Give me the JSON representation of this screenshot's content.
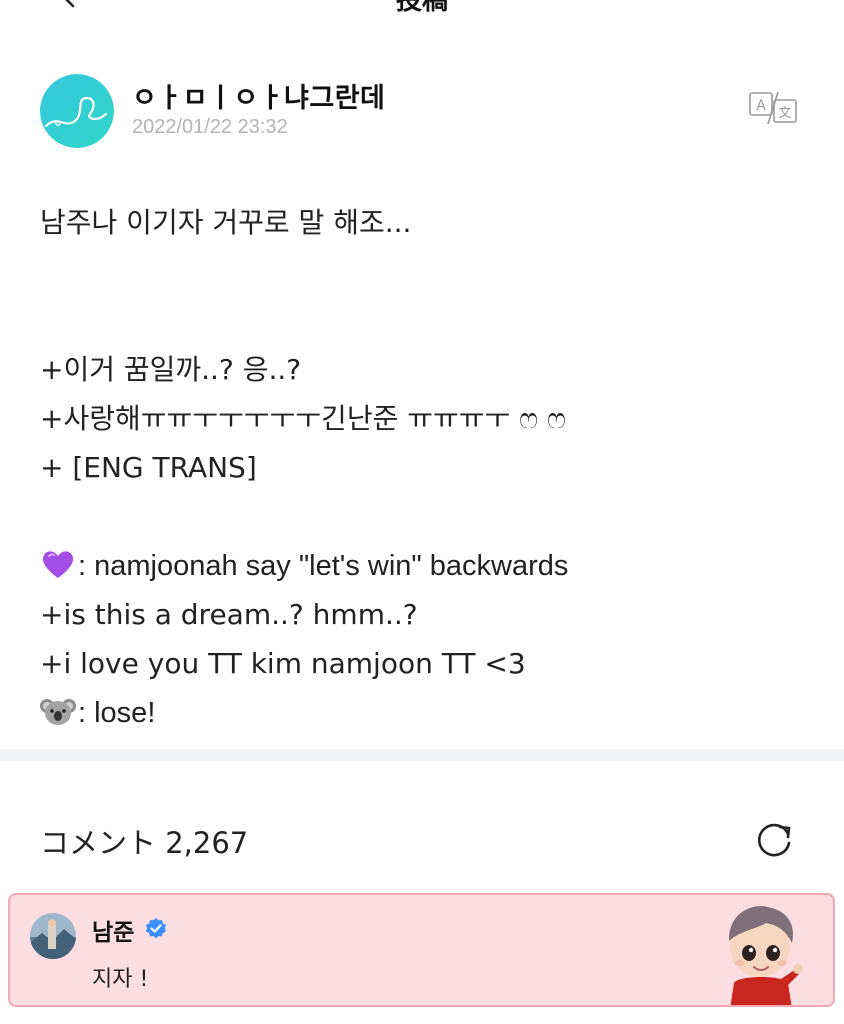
{
  "nav": {
    "title": "投稿",
    "back_icon": "chevron-left-icon"
  },
  "post": {
    "author": "ㅇㅏㅁㅣㅇㅏ냐그란데",
    "date": "2022/01/22 23:32",
    "translate_icon": "translate-icon",
    "lines": [
      "남주나 이기자 거꾸로 말 해조...",
      "",
      "",
      "+이거 꿈일까..? 응..?",
      "+사랑해ㅠㅠㅜㅜㅜㅜㅜ긴난준 ㅠㅠㅠㅜ ෆ ෆ",
      "+ [ENG TRANS]",
      "",
      ": namjoonah say \"let's win\" backwards",
      "+is this a dream..? hmm..?",
      "+i love you TT kim namjoon TT <3",
      ": lose!"
    ],
    "line_emojis": [
      "",
      "",
      "",
      "",
      "",
      "",
      "",
      "purple-heart",
      "",
      "",
      "koala"
    ]
  },
  "comments": {
    "label": "コメント 2,267",
    "refresh_icon": "refresh-icon"
  },
  "highlight_comment": {
    "author": "남준",
    "verified_icon": "verified-badge-icon",
    "text": "지자 !",
    "background": "#fbdde2",
    "border": "#f2a8b6"
  },
  "colors": {
    "accent_verified": "#3b8df7",
    "avatar_gradient_start": "#36c7de",
    "avatar_gradient_end": "#2fd6c7",
    "divider": "#f3f4f6"
  }
}
